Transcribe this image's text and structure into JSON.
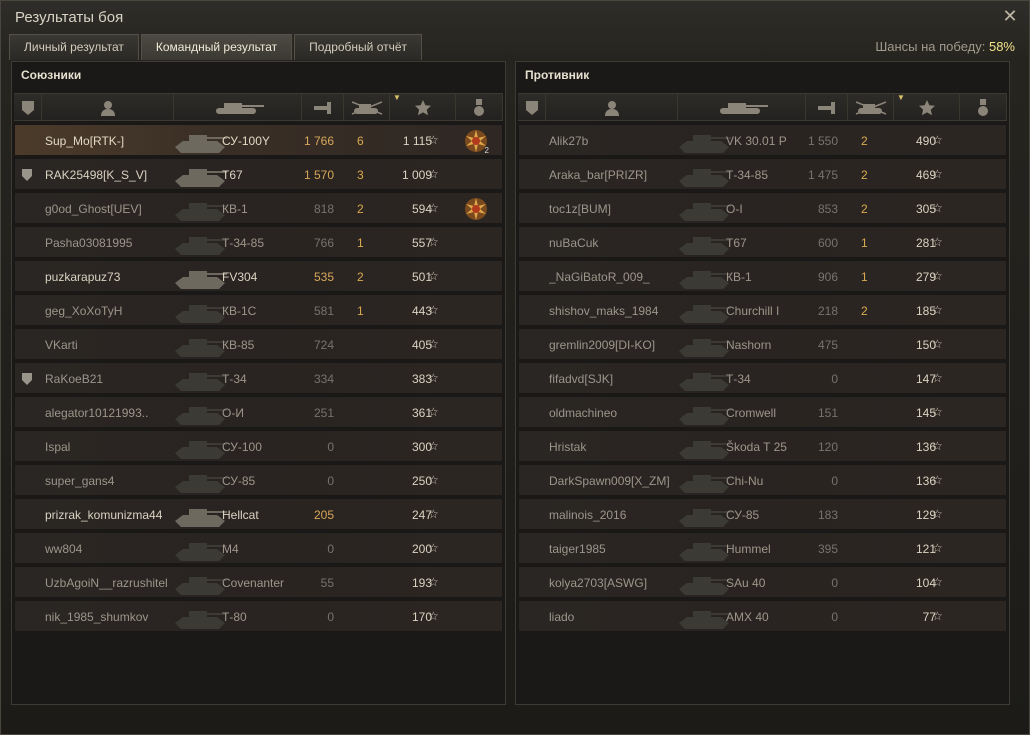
{
  "window": {
    "title": "Результаты боя"
  },
  "tabs": [
    {
      "label": "Личный результат",
      "active": false
    },
    {
      "label": "Командный результат",
      "active": true
    },
    {
      "label": "Подробный отчёт",
      "active": false
    }
  ],
  "win_chance": {
    "label": "Шансы на победу:",
    "value": "58%"
  },
  "allies": {
    "title": "Союзники",
    "rows": [
      {
        "name": "Sup_Mo[RTK-]",
        "tank": "СУ-100Y",
        "damage": "1 766",
        "kills": "6",
        "xp": "1 115",
        "clan": false,
        "medal": true,
        "medal_count": "2",
        "style": "me"
      },
      {
        "name": "RAK25498[K_S_V]",
        "tank": "T67",
        "damage": "1 570",
        "kills": "3",
        "xp": "1 009",
        "clan": true,
        "medal": false,
        "style": "light"
      },
      {
        "name": "g0od_Ghost[UEV]",
        "tank": "КВ-1",
        "damage": "818",
        "kills": "2",
        "xp": "594",
        "clan": false,
        "medal": true,
        "medal_count": "",
        "style": ""
      },
      {
        "name": "Pasha03081995",
        "tank": "Т-34-85",
        "damage": "766",
        "kills": "1",
        "xp": "557",
        "clan": false,
        "medal": false,
        "style": ""
      },
      {
        "name": "puzkarapuz73",
        "tank": "FV304",
        "damage": "535",
        "kills": "2",
        "xp": "501",
        "clan": false,
        "medal": false,
        "style": "light"
      },
      {
        "name": "geg_XoXoTyH",
        "tank": "КВ-1С",
        "damage": "581",
        "kills": "1",
        "xp": "443",
        "clan": false,
        "medal": false,
        "style": ""
      },
      {
        "name": "VKarti",
        "tank": "КВ-85",
        "damage": "724",
        "kills": "",
        "xp": "405",
        "clan": false,
        "medal": false,
        "style": ""
      },
      {
        "name": "RaKoeB21",
        "tank": "Т-34",
        "damage": "334",
        "kills": "",
        "xp": "383",
        "clan": true,
        "medal": false,
        "style": ""
      },
      {
        "name": "alegator10121993..",
        "tank": "О-И",
        "damage": "251",
        "kills": "",
        "xp": "361",
        "clan": false,
        "medal": false,
        "style": ""
      },
      {
        "name": "Ispal",
        "tank": "СУ-100",
        "damage": "0",
        "kills": "",
        "xp": "300",
        "clan": false,
        "medal": false,
        "style": ""
      },
      {
        "name": "super_gans4",
        "tank": "СУ-85",
        "damage": "0",
        "kills": "",
        "xp": "250",
        "clan": false,
        "medal": false,
        "style": ""
      },
      {
        "name": "prizrak_komunizma44",
        "tank": "Hellcat",
        "damage": "205",
        "kills": "",
        "xp": "247",
        "clan": false,
        "medal": false,
        "style": "light"
      },
      {
        "name": "ww804",
        "tank": "M4",
        "damage": "0",
        "kills": "",
        "xp": "200",
        "clan": false,
        "medal": false,
        "style": ""
      },
      {
        "name": "UzbAgoiN__razrushitel",
        "tank": "Covenanter",
        "damage": "55",
        "kills": "",
        "xp": "193",
        "clan": false,
        "medal": false,
        "style": ""
      },
      {
        "name": "nik_1985_shumkov",
        "tank": "Т-80",
        "damage": "0",
        "kills": "",
        "xp": "170",
        "clan": false,
        "medal": false,
        "style": ""
      }
    ]
  },
  "enemies": {
    "title": "Противник",
    "rows": [
      {
        "name": "Alik27b",
        "tank": "VK 30.01 P",
        "damage": "1 550",
        "kills": "2",
        "xp": "490",
        "clan": false,
        "medal": false,
        "style": ""
      },
      {
        "name": "Araka_bar[PRIZR]",
        "tank": "Т-34-85",
        "damage": "1 475",
        "kills": "2",
        "xp": "469",
        "clan": false,
        "medal": false,
        "style": ""
      },
      {
        "name": "toc1z[BUM]",
        "tank": "О-I",
        "damage": "853",
        "kills": "2",
        "xp": "305",
        "clan": false,
        "medal": false,
        "style": ""
      },
      {
        "name": "nuBaCuk",
        "tank": "T67",
        "damage": "600",
        "kills": "1",
        "xp": "281",
        "clan": false,
        "medal": false,
        "style": ""
      },
      {
        "name": "_NaGiBatoR_009_",
        "tank": "КВ-1",
        "damage": "906",
        "kills": "1",
        "xp": "279",
        "clan": false,
        "medal": false,
        "style": ""
      },
      {
        "name": "shishov_maks_1984",
        "tank": "Churchill I",
        "damage": "218",
        "kills": "2",
        "xp": "185",
        "clan": false,
        "medal": false,
        "style": ""
      },
      {
        "name": "gremlin2009[DI-KO]",
        "tank": "Nashorn",
        "damage": "475",
        "kills": "",
        "xp": "150",
        "clan": false,
        "medal": false,
        "style": ""
      },
      {
        "name": "fifadvd[SJK]",
        "tank": "Т-34",
        "damage": "0",
        "kills": "",
        "xp": "147",
        "clan": false,
        "medal": false,
        "style": ""
      },
      {
        "name": "oldmachineo",
        "tank": "Cromwell",
        "damage": "151",
        "kills": "",
        "xp": "145",
        "clan": false,
        "medal": false,
        "style": ""
      },
      {
        "name": "Hristak",
        "tank": "Škoda T 25",
        "damage": "120",
        "kills": "",
        "xp": "136",
        "clan": false,
        "medal": false,
        "style": ""
      },
      {
        "name": "DarkSpawn009[X_ZM]",
        "tank": "Chi-Nu",
        "damage": "0",
        "kills": "",
        "xp": "136",
        "clan": false,
        "medal": false,
        "style": ""
      },
      {
        "name": "malinois_2016",
        "tank": "СУ-85",
        "damage": "183",
        "kills": "",
        "xp": "129",
        "clan": false,
        "medal": false,
        "style": ""
      },
      {
        "name": "taiger1985",
        "tank": "Hummel",
        "damage": "395",
        "kills": "",
        "xp": "121",
        "clan": false,
        "medal": false,
        "style": ""
      },
      {
        "name": "kolya2703[ASWG]",
        "tank": "SAu 40",
        "damage": "0",
        "kills": "",
        "xp": "104",
        "clan": false,
        "medal": false,
        "style": ""
      },
      {
        "name": "liado",
        "tank": "AMX 40",
        "damage": "0",
        "kills": "",
        "xp": "77",
        "clan": false,
        "medal": false,
        "style": ""
      }
    ]
  },
  "icons": {
    "close": "close-icon",
    "columns": [
      "clan-badge-icon",
      "player-icon",
      "tank-icon",
      "damage-icon",
      "kills-icon",
      "experience-star-icon",
      "medal-icon"
    ]
  },
  "colors": {
    "accent": "#f2e38a",
    "kills": "#d9a94f",
    "damage_highlight": "#d7a75a"
  }
}
